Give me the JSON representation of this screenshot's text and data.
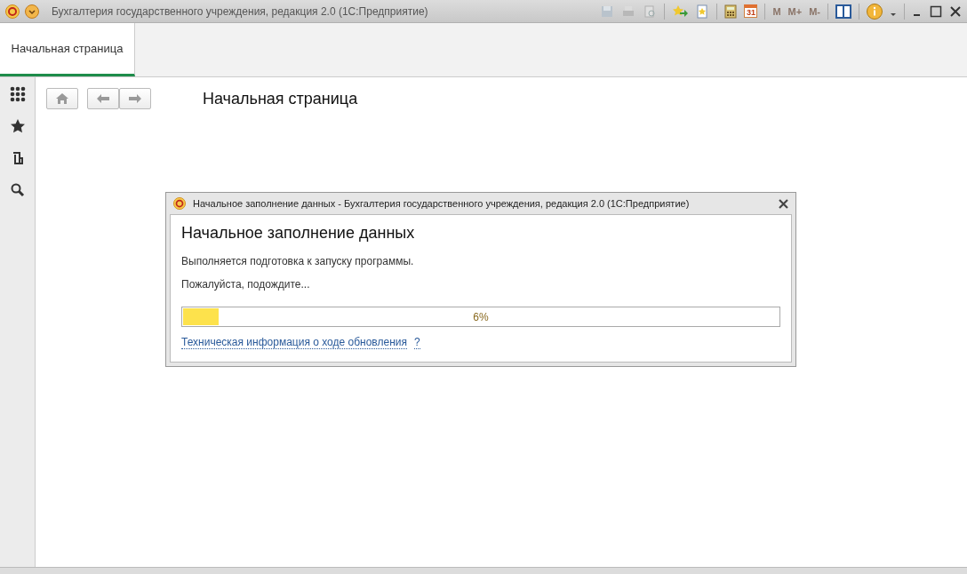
{
  "window": {
    "title": "Бухгалтерия государственного учреждения, редакция 2.0  (1С:Предприятие)",
    "toolbar": {
      "memory_buttons": [
        "M",
        "M+",
        "M-"
      ],
      "calendar_day": "31"
    }
  },
  "tabs": [
    {
      "label": "Начальная страница",
      "selected": true
    }
  ],
  "page": {
    "title": "Начальная страница"
  },
  "dialog": {
    "title": "Начальное заполнение данных - Бухгалтерия государственного учреждения, редакция 2.0  (1С:Предприятие)",
    "heading": "Начальное заполнение данных",
    "messages": [
      "Выполняется подготовка к запуску программы.",
      "Пожалуйста, подождите..."
    ],
    "progress": {
      "level": 0.06,
      "reading": "6%"
    },
    "link": "Техническая информация о ходе обновления",
    "help": "?"
  }
}
